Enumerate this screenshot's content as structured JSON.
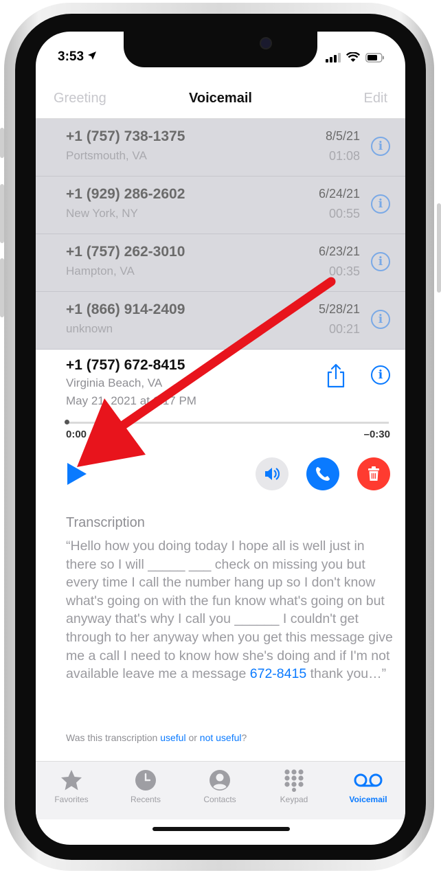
{
  "status": {
    "time": "3:53"
  },
  "nav": {
    "left": "Greeting",
    "title": "Voicemail",
    "right": "Edit"
  },
  "voicemails": [
    {
      "number": "+1 (757) 738-1375",
      "location": "Portsmouth, VA",
      "date": "8/5/21",
      "duration": "01:08"
    },
    {
      "number": "+1 (929) 286-2602",
      "location": "New York, NY",
      "date": "6/24/21",
      "duration": "00:55"
    },
    {
      "number": "+1 (757) 262-3010",
      "location": "Hampton, VA",
      "date": "6/23/21",
      "duration": "00:35"
    },
    {
      "number": "+1 (866) 914-2409",
      "location": "unknown",
      "date": "5/28/21",
      "duration": "00:21"
    }
  ],
  "detail": {
    "number": "+1 (757) 672-8415",
    "location": "Virginia Beach, VA",
    "datetime": "May 21, 2021 at 1:17 PM",
    "time_start": "0:00",
    "time_end": "–0:30",
    "transcription_heading": "Transcription",
    "transcription_text": "“Hello how you doing today I hope all is well just in there so I will _____ ___ check on missing you but every time I call the number hang up so I don't know what's going on with the fun know what's going on but anyway that's why I call you ______ I couldn't get through to her anyway when you get this message give me a call I need to know how she's doing and if I'm not available leave me a message ",
    "transcription_link": "672-8415",
    "transcription_end": " thank you…”",
    "feedback_prefix": "Was this transcription ",
    "feedback_useful": "useful",
    "feedback_or": " or ",
    "feedback_not_useful": "not useful",
    "feedback_suffix": "?"
  },
  "tabs": [
    {
      "label": "Favorites",
      "icon": "star-icon"
    },
    {
      "label": "Recents",
      "icon": "clock-icon"
    },
    {
      "label": "Contacts",
      "icon": "person-icon"
    },
    {
      "label": "Keypad",
      "icon": "keypad-icon"
    },
    {
      "label": "Voicemail",
      "icon": "voicemail-icon",
      "active": true
    }
  ],
  "colors": {
    "accent": "#0a7aff",
    "delete": "#ff3b30",
    "annotation_arrow": "#e8141c"
  }
}
